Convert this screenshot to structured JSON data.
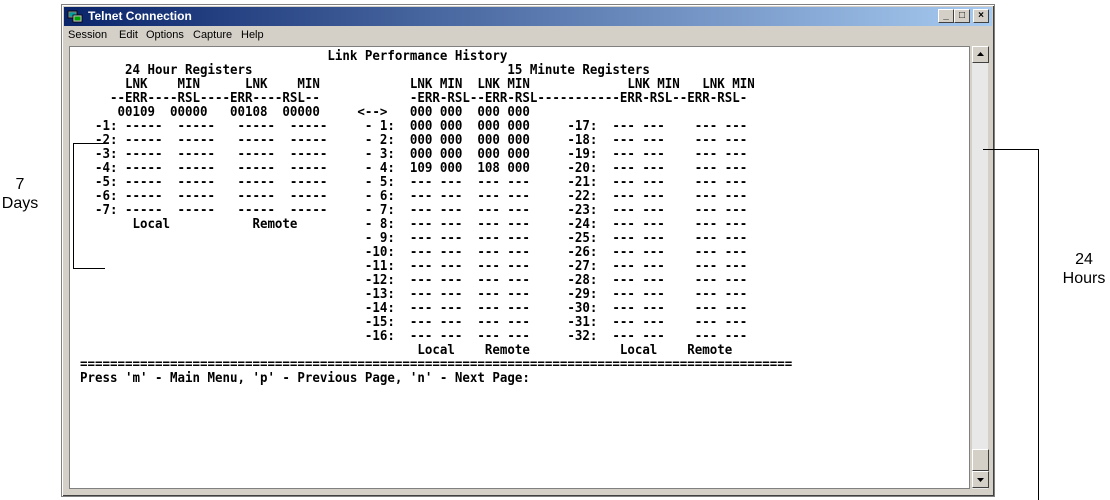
{
  "window": {
    "title": "Telnet Connection",
    "controls": {
      "minimize": "_",
      "maximize": "□",
      "close": "×"
    }
  },
  "menu": [
    "Session",
    "Edit",
    "Options",
    "Capture",
    "Help"
  ],
  "terminal": {
    "lines": [
      "                                 Link Performance History",
      "      24 Hour Registers                                  15 Minute Registers",
      "      LNK    MIN      LNK    MIN            LNK MIN  LNK MIN             LNK MIN   LNK MIN",
      "    --ERR----RSL----ERR----RSL--            -ERR-RSL--ERR-RSL-----------ERR-RSL--ERR-RSL-",
      "     00109  00000   00108  00000     <-->   000 000  000 000",
      "  -1: -----  -----   -----  -----     - 1:  000 000  000 000     -17:  --- ---    --- ---",
      "  -2: -----  -----   -----  -----     - 2:  000 000  000 000     -18:  --- ---    --- ---",
      "  -3: -----  -----   -----  -----     - 3:  000 000  000 000     -19:  --- ---    --- ---",
      "  -4: -----  -----   -----  -----     - 4:  109 000  108 000     -20:  --- ---    --- ---",
      "  -5: -----  -----   -----  -----     - 5:  --- ---  --- ---     -21:  --- ---    --- ---",
      "  -6: -----  -----   -----  -----     - 6:  --- ---  --- ---     -22:  --- ---    --- ---",
      "  -7: -----  -----   -----  -----     - 7:  --- ---  --- ---     -23:  --- ---    --- ---",
      "       Local           Remote         - 8:  --- ---  --- ---     -24:  --- ---    --- ---",
      "                                      - 9:  --- ---  --- ---     -25:  --- ---    --- ---",
      "                                      -10:  --- ---  --- ---     -26:  --- ---    --- ---",
      "                                      -11:  --- ---  --- ---     -27:  --- ---    --- ---",
      "                                      -12:  --- ---  --- ---     -28:  --- ---    --- ---",
      "                                      -13:  --- ---  --- ---     -29:  --- ---    --- ---",
      "                                      -14:  --- ---  --- ---     -30:  --- ---    --- ---",
      "                                      -15:  --- ---  --- ---     -31:  --- ---    --- ---",
      "                                      -16:  --- ---  --- ---     -32:  --- ---    --- ---",
      "                                             Local    Remote            Local    Remote",
      "===============================================================================================",
      "Press 'm' - Main Menu, 'p' - Previous Page, 'n' - Next Page:"
    ]
  },
  "annotations": {
    "days": "7\nDays",
    "hours": "24\nHours"
  }
}
